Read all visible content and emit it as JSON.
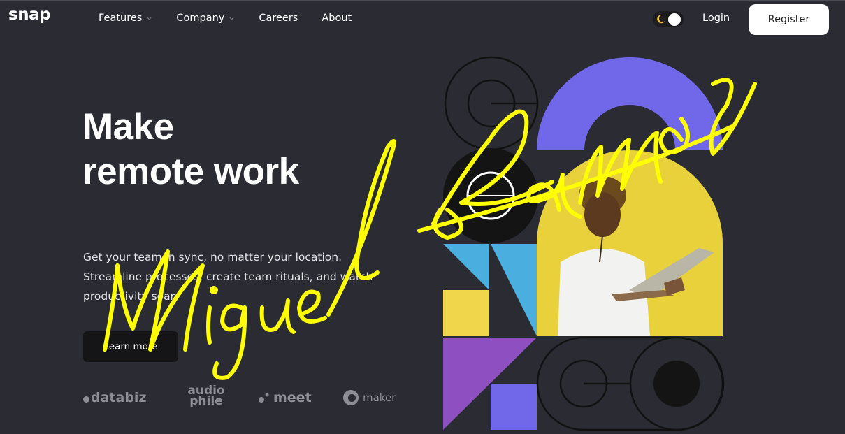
{
  "header": {
    "logo": "snap",
    "nav": [
      {
        "label": "Features",
        "has_dropdown": true
      },
      {
        "label": "Company",
        "has_dropdown": true
      },
      {
        "label": "Careers",
        "has_dropdown": false
      },
      {
        "label": "About",
        "has_dropdown": false
      }
    ],
    "login": "Login",
    "register": "Register"
  },
  "hero": {
    "title_line1": "Make",
    "title_line2": "remote work",
    "desc_line1": "Get your team in sync, no matter your location.",
    "desc_line2": "Streamline processes, create team rituals, and watch",
    "desc_line3": "productivity soar.",
    "cta": "Learn more"
  },
  "clients": {
    "databiz": "databiz",
    "audiophile_1": "audio",
    "audiophile_2": "phile",
    "meet": "meet",
    "maker": "maker"
  },
  "overlay": {
    "signature": "Miguel Ramos"
  },
  "colors": {
    "background": "#2a2b33",
    "purple": "#7068e8",
    "yellow": "#f0d64a",
    "blue": "#4aaede",
    "violet": "#8e4fc1",
    "signature": "#ffff00"
  }
}
